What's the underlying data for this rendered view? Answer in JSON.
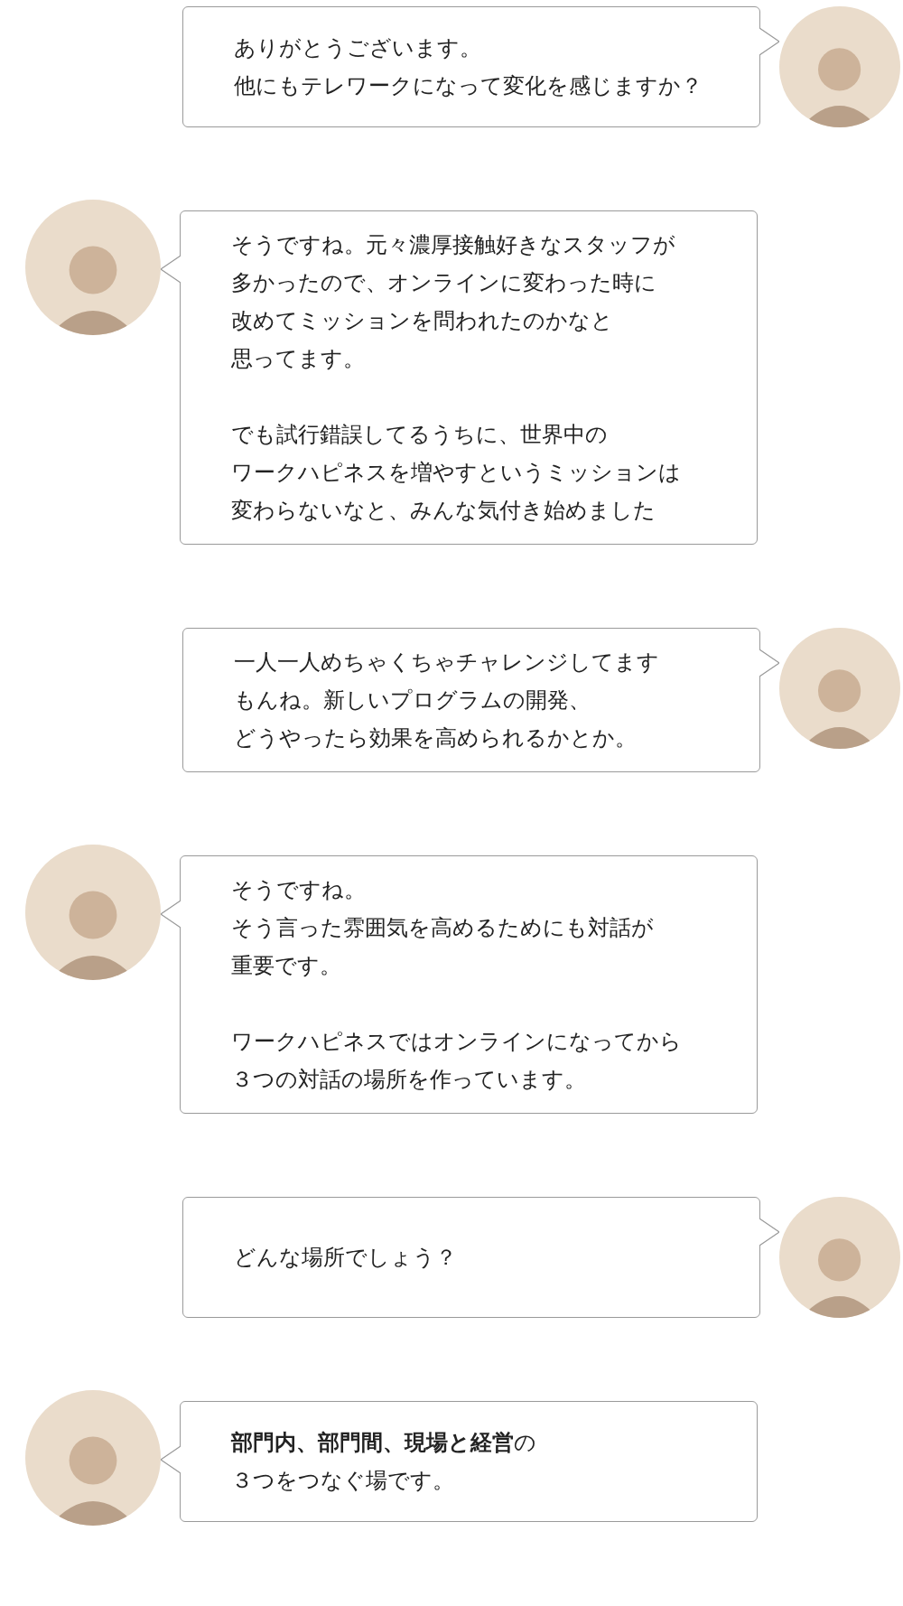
{
  "messages": [
    {
      "kind": "right",
      "paragraphs": [
        [
          "ありがとうございます。",
          "他にもテレワークになって変化を感じますか？"
        ]
      ]
    },
    {
      "kind": "left",
      "paragraphs": [
        [
          "そうですね。元々濃厚接触好きなスタッフが",
          "多かったので、オンラインに変わった時に",
          "改めてミッションを問われたのかなと",
          "思ってます。"
        ],
        [
          "でも試行錯誤してるうちに、世界中の",
          "ワークハピネスを増やすというミッションは",
          "変わらないなと、みんな気付き始めました"
        ]
      ]
    },
    {
      "kind": "right",
      "paragraphs": [
        [
          "一人一人めちゃくちゃチャレンジしてます",
          "もんね。新しいプログラムの開発、",
          "どうやったら効果を高められるかとか。"
        ]
      ]
    },
    {
      "kind": "left",
      "paragraphs": [
        [
          "そうですね。",
          "そう言った雰囲気を高めるためにも対話が",
          "重要です。"
        ],
        [
          "ワークハピネスではオンラインになってから",
          "３つの対話の場所を作っています。"
        ]
      ]
    },
    {
      "kind": "right",
      "paragraphs": [
        [
          "どんな場所でしょう？"
        ]
      ]
    },
    {
      "kind": "left",
      "paragraphs": [
        [
          "**部門内、部門間、現場と経営**の",
          "３つをつなぐ場です。"
        ]
      ]
    }
  ]
}
